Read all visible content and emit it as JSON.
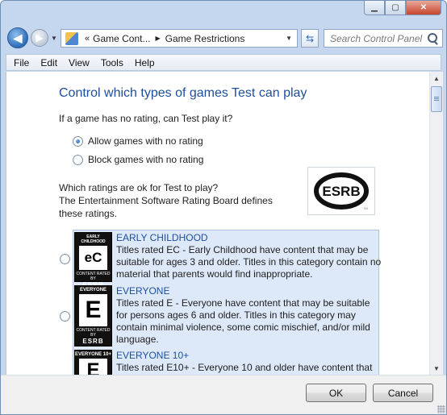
{
  "window": {
    "caption_buttons": {
      "minimize_icon": "minimize-icon",
      "maximize_icon": "maximize-icon",
      "close_icon": "close-icon"
    }
  },
  "address_bar": {
    "overflow": "«",
    "breadcrumbs": [
      "Game Cont...",
      "Game Restrictions"
    ],
    "separator": "▶"
  },
  "search": {
    "placeholder": "Search Control Panel"
  },
  "menu": [
    "File",
    "Edit",
    "View",
    "Tools",
    "Help"
  ],
  "page": {
    "title": "Control which types of games Test can play",
    "unrated_question": "If a game has no rating, can Test play it?",
    "unrated_options": [
      {
        "label": "Allow games with no rating",
        "selected": true
      },
      {
        "label": "Block games with no rating",
        "selected": false
      }
    ],
    "ratings_question_line1": "Which ratings are ok for Test to play?",
    "ratings_question_line2": "The Entertainment Software Rating Board defines",
    "ratings_question_line3": "these ratings.",
    "esrb_logo_text": "ESRB",
    "esrb_logo_tm": "TM",
    "ratings": [
      {
        "name": "EARLY CHILDHOOD",
        "badge_top": "EARLY CHILDHOOD",
        "badge_letter": "eC",
        "description": "Titles rated EC - Early Childhood have content that may be suitable for ages 3 and older.  Titles in this category contain no material that parents would find inappropriate.",
        "selected": false
      },
      {
        "name": "EVERYONE",
        "badge_top": "EVERYONE",
        "badge_letter": "E",
        "description": "Titles rated E - Everyone have content that may be suitable for persons ages 6 and older.  Titles in this category may contain minimal violence, some comic mischief, and/or mild language.",
        "selected": false
      },
      {
        "name": "EVERYONE 10+",
        "badge_top": "EVERYONE 10+",
        "badge_letter": "E",
        "description": "Titles rated E10+ - Everyone 10 and older have content that",
        "selected": false
      }
    ],
    "badge_bottom": "CONTENT RATED BY",
    "badge_esrb": "ESRB"
  },
  "footer": {
    "ok_label": "OK",
    "cancel_label": "Cancel"
  }
}
